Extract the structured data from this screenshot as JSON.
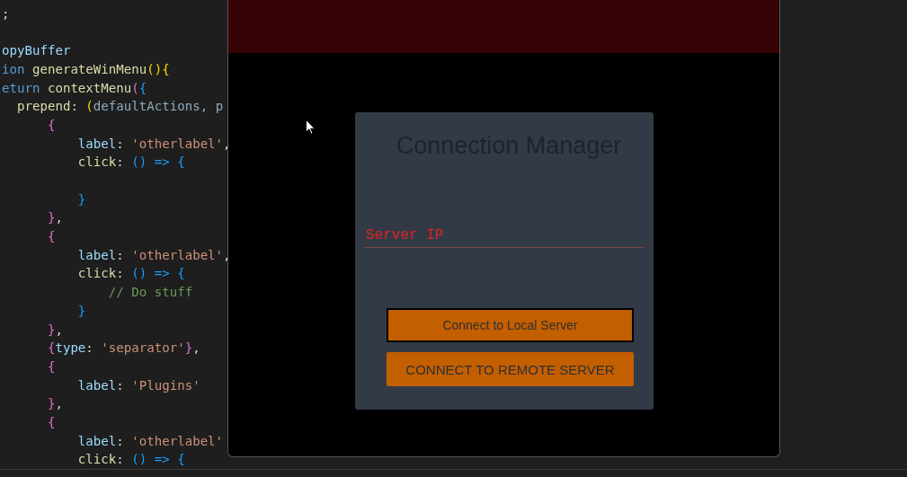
{
  "code_editor": {
    "lines": [
      {
        "kind": "code",
        "tokens": [
          {
            "text": ";",
            "kind": "punct"
          }
        ]
      },
      {
        "kind": "blank"
      },
      {
        "kind": "code",
        "tokens": [
          {
            "text": "opyBuffer",
            "kind": "var"
          }
        ]
      },
      {
        "kind": "code",
        "tokens": [
          {
            "text": "ion ",
            "kind": "keyword"
          },
          {
            "text": "generateWinMenu",
            "kind": "func"
          },
          {
            "text": "(){",
            "kind": "brace1"
          }
        ]
      },
      {
        "kind": "code",
        "tokens": [
          {
            "text": "eturn ",
            "kind": "keyword"
          },
          {
            "text": "contextMenu",
            "kind": "func"
          },
          {
            "text": "(",
            "kind": "brace2"
          },
          {
            "text": "{",
            "kind": "brace3"
          }
        ]
      },
      {
        "kind": "code",
        "tokens": [
          {
            "text": "  prepend",
            "kind": "func"
          },
          {
            "text": ": ",
            "kind": "punct"
          },
          {
            "text": "(",
            "kind": "brace1"
          },
          {
            "text": "defaultActions",
            "kind": "param"
          },
          {
            "text": ", p",
            "kind": "param"
          }
        ]
      },
      {
        "kind": "code",
        "tokens": [
          {
            "text": "      {",
            "kind": "brace2"
          }
        ]
      },
      {
        "kind": "code",
        "tokens": [
          {
            "text": "          label",
            "kind": "var"
          },
          {
            "text": ": ",
            "kind": "punct"
          },
          {
            "text": "'otherlabel'",
            "kind": "string"
          },
          {
            "text": ",",
            "kind": "punct"
          }
        ]
      },
      {
        "kind": "code",
        "tokens": [
          {
            "text": "          click",
            "kind": "func"
          },
          {
            "text": ": ",
            "kind": "punct"
          },
          {
            "text": "() => {",
            "kind": "brace3"
          }
        ]
      },
      {
        "kind": "blank"
      },
      {
        "kind": "code",
        "tokens": [
          {
            "text": "          }",
            "kind": "brace3"
          }
        ]
      },
      {
        "kind": "code",
        "tokens": [
          {
            "text": "      }",
            "kind": "brace2"
          },
          {
            "text": ",",
            "kind": "punct"
          }
        ]
      },
      {
        "kind": "code",
        "tokens": [
          {
            "text": "      {",
            "kind": "brace2"
          }
        ]
      },
      {
        "kind": "code",
        "tokens": [
          {
            "text": "          label",
            "kind": "var"
          },
          {
            "text": ": ",
            "kind": "punct"
          },
          {
            "text": "'otherlabel'",
            "kind": "string"
          },
          {
            "text": ",",
            "kind": "punct"
          }
        ]
      },
      {
        "kind": "code",
        "tokens": [
          {
            "text": "          click",
            "kind": "func"
          },
          {
            "text": ": ",
            "kind": "punct"
          },
          {
            "text": "() => {",
            "kind": "brace3"
          }
        ]
      },
      {
        "kind": "code",
        "tokens": [
          {
            "text": "              // Do stuff",
            "kind": "comment"
          }
        ]
      },
      {
        "kind": "code",
        "tokens": [
          {
            "text": "          }",
            "kind": "brace3"
          }
        ]
      },
      {
        "kind": "code",
        "tokens": [
          {
            "text": "      }",
            "kind": "brace2"
          },
          {
            "text": ",",
            "kind": "punct"
          }
        ]
      },
      {
        "kind": "code",
        "tokens": [
          {
            "text": "      {",
            "kind": "brace2"
          },
          {
            "text": "type",
            "kind": "var"
          },
          {
            "text": ": ",
            "kind": "punct"
          },
          {
            "text": "'separator'",
            "kind": "string"
          },
          {
            "text": "}",
            "kind": "brace2"
          },
          {
            "text": ",",
            "kind": "punct"
          }
        ]
      },
      {
        "kind": "code",
        "tokens": [
          {
            "text": "      {",
            "kind": "brace2"
          }
        ]
      },
      {
        "kind": "code",
        "tokens": [
          {
            "text": "          label",
            "kind": "var"
          },
          {
            "text": ": ",
            "kind": "punct"
          },
          {
            "text": "'Plugins'",
            "kind": "string"
          }
        ]
      },
      {
        "kind": "code",
        "tokens": [
          {
            "text": "      }",
            "kind": "brace2"
          },
          {
            "text": ",",
            "kind": "punct"
          }
        ]
      },
      {
        "kind": "code",
        "tokens": [
          {
            "text": "      {",
            "kind": "brace2"
          }
        ]
      },
      {
        "kind": "code",
        "tokens": [
          {
            "text": "          label",
            "kind": "var"
          },
          {
            "text": ": ",
            "kind": "punct"
          },
          {
            "text": "'otherlabel'",
            "kind": "string"
          }
        ]
      },
      {
        "kind": "code",
        "tokens": [
          {
            "text": "          click",
            "kind": "func"
          },
          {
            "text": ": ",
            "kind": "punct"
          },
          {
            "text": "() => {",
            "kind": "brace3"
          }
        ]
      }
    ]
  },
  "app_window": {
    "dialog": {
      "title": "Connection Manager",
      "field": {
        "placeholder": "Server IP"
      },
      "buttons": [
        {
          "label": "Connect to Local Server",
          "focused": true
        },
        {
          "label": "CONNECT TO REMOTE SERVER",
          "focused": false
        }
      ]
    }
  }
}
